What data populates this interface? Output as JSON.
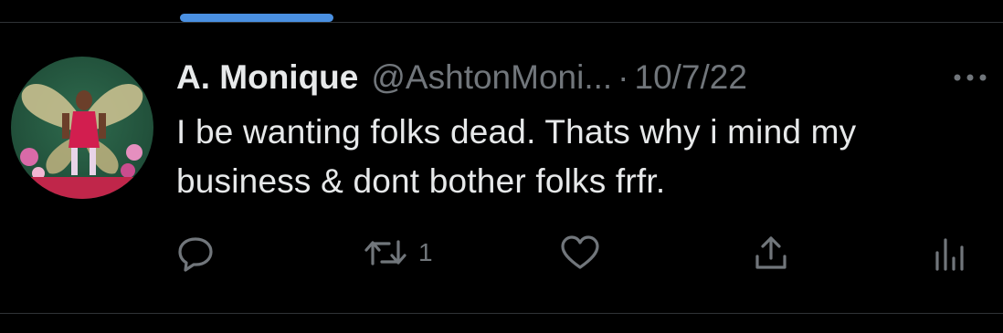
{
  "tweet": {
    "author_name": "A. Monique",
    "author_handle": "@AshtonMoni...",
    "separator": "·",
    "date": "10/7/22",
    "text": "I be wanting folks dead. Thats why i mind my business & dont bother folks frfr."
  },
  "actions": {
    "reply_icon": "reply-icon",
    "retweet_icon": "retweet-icon",
    "retweet_count": "1",
    "like_icon": "heart-icon",
    "share_icon": "share-icon",
    "analytics_icon": "analytics-icon",
    "more_icon": "more-icon"
  },
  "colors": {
    "background": "#000000",
    "text_primary": "#e7e9ea",
    "text_secondary": "#71767b",
    "accent": "#4a90e2"
  }
}
